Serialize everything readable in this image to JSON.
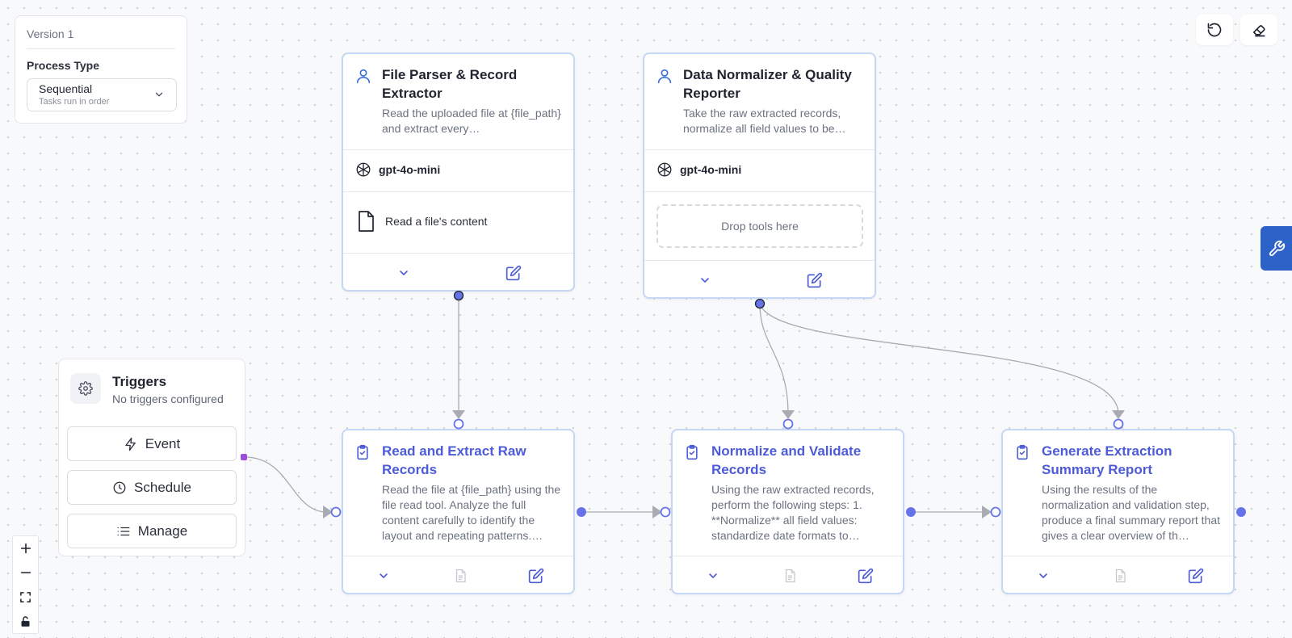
{
  "version_panel": {
    "version": "Version 1",
    "process_type_label": "Process Type",
    "process_type_value": "Sequential",
    "process_type_hint": "Tasks run in order"
  },
  "agents": [
    {
      "title": "File Parser & Record Extractor",
      "description": "Read the uploaded file at {file_path} and extract every…",
      "model": "gpt-4o-mini",
      "tool": "Read a file's content"
    },
    {
      "title": "Data Normalizer & Quality Reporter",
      "description": "Take the raw extracted records, normalize all field values to be…",
      "model": "gpt-4o-mini",
      "tool_placeholder": "Drop tools here"
    }
  ],
  "tasks": [
    {
      "title": "Read and Extract Raw Records",
      "description": "Read the file at {file_path} using the file read tool. Analyze the full content carefully to identify the layout and repeating patterns.…"
    },
    {
      "title": "Normalize and Validate Records",
      "description": "Using the raw extracted records, perform the following steps: 1. **Normalize** all field values: standardize date formats to…"
    },
    {
      "title": "Generate Extraction Summary Report",
      "description": "Using the results of the normalization and validation step, produce a final summary report that gives a clear overview of th…"
    }
  ],
  "triggers": {
    "title": "Triggers",
    "subtitle": "No triggers configured",
    "buttons": [
      "Event",
      "Schedule",
      "Manage"
    ]
  },
  "colors": {
    "task_accent": "#4d5cd6",
    "agent_border": "#c6d6f5",
    "handle_fill": "#6673e8",
    "trigger_handle": "#9b4ddb",
    "side_tab": "#2d63c8"
  },
  "icons": {
    "agent": "user-icon",
    "model": "openai-icon",
    "tool": "file-icon",
    "task": "clipboard-check-icon",
    "expand": "chevron-down-icon",
    "edit": "edit-icon",
    "output": "document-icon",
    "reset": "undo-icon",
    "clear": "eraser-icon",
    "tools_tab": "wrench-icon"
  }
}
